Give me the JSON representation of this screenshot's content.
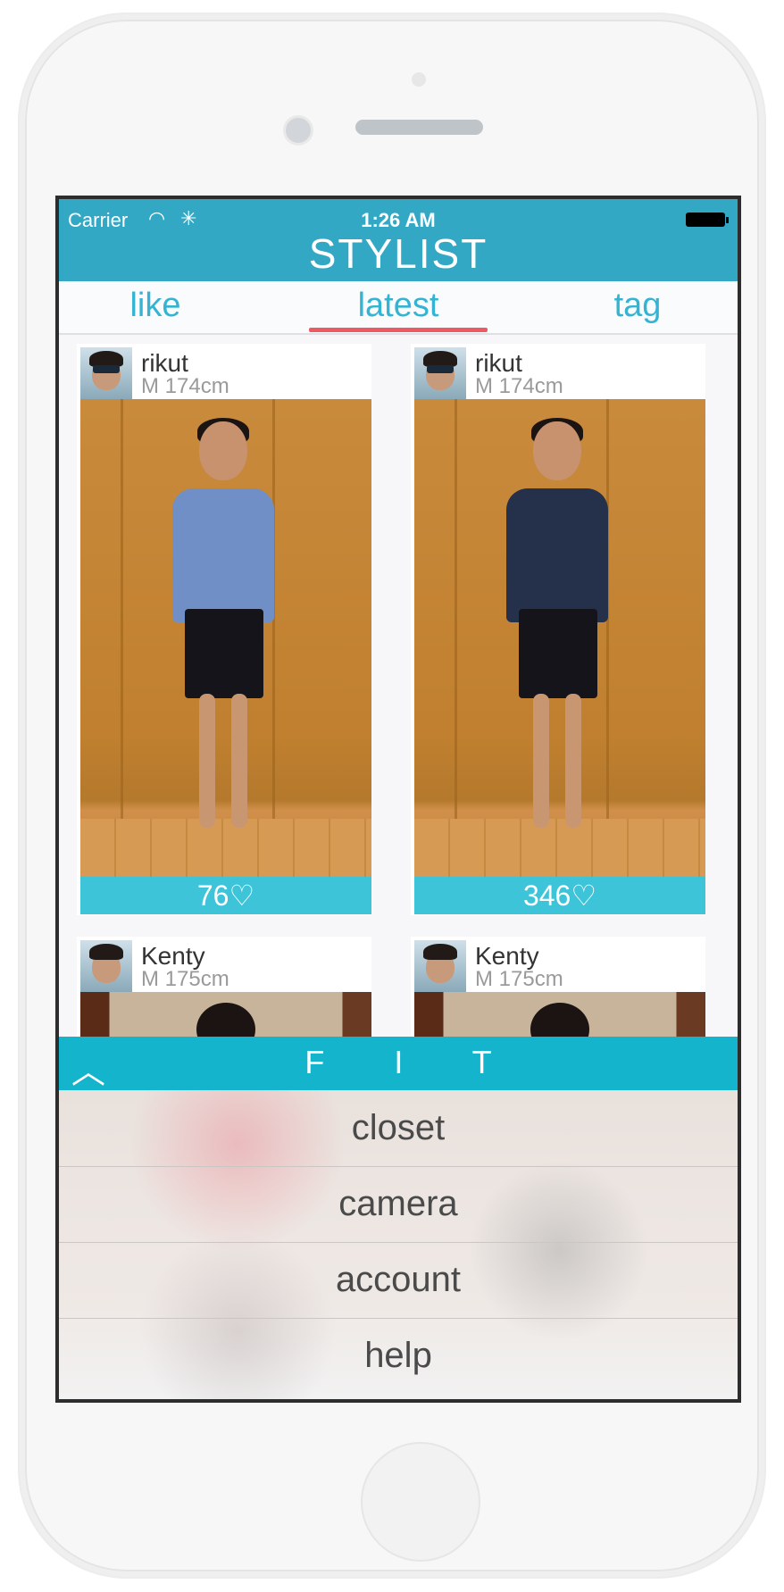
{
  "status_bar": {
    "carrier": "Carrier",
    "time": "1:26 AM"
  },
  "app": {
    "title": "STYLIST"
  },
  "tabs": [
    {
      "label": "like"
    },
    {
      "label": "latest",
      "selected": true
    },
    {
      "label": "tag"
    }
  ],
  "feed": [
    {
      "user": "rikut",
      "meta": "M 174cm",
      "likes": "76♡",
      "shirt_color": "#6f8fc6"
    },
    {
      "user": "rikut",
      "meta": "M 174cm",
      "likes": "346♡",
      "shirt_color": "#25304a"
    },
    {
      "user": "Kenty",
      "meta": "M 175cm"
    },
    {
      "user": "Kenty",
      "meta": "M 175cm"
    }
  ],
  "bottom_menu": {
    "title": "F I T",
    "toggle_icon": "chevron-up-icon",
    "items": [
      "closet",
      "camera",
      "account",
      "help"
    ]
  },
  "colors": {
    "accent": "#32a8c4",
    "tab_text": "#33b4d3",
    "indicator": "#ec5a64",
    "likes_bar": "#3ec4d8",
    "menu_bar": "#15b4cd"
  }
}
